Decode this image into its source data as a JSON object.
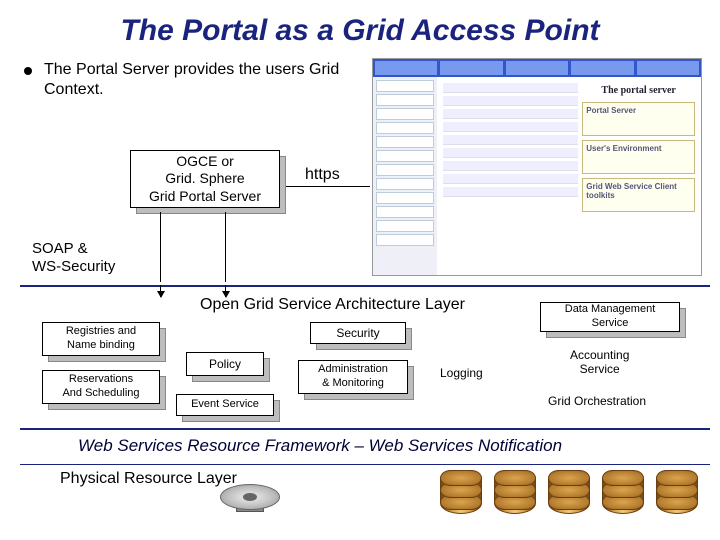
{
  "title": "The Portal as a Grid Access Point",
  "bullet": "The Portal Server provides the users Grid Context.",
  "boxes": {
    "portal_server": "OGCE or\nGrid. Sphere\nGrid Portal Server",
    "registries": "Registries and\nName binding",
    "reservations": "Reservations\nAnd Scheduling",
    "policy": "Policy",
    "event_service": "Event Service",
    "security": "Security",
    "admin": "Administration\n& Monitoring",
    "data_mgmt": "Data Management\nService"
  },
  "labels": {
    "https": "https",
    "soap": "SOAP &\nWS-Security",
    "ogsa": "Open Grid Service Architecture Layer",
    "logging": "Logging",
    "accounting": "Accounting\nService",
    "grid_orch": "Grid Orchestration"
  },
  "lines": {
    "wsrf": "Web Services Resource Framework – Web Services Notification",
    "physical": "Physical Resource Layer"
  },
  "screenshot": {
    "heading": "The portal server",
    "panel1": "Portal Server",
    "panel2": "User's Environment",
    "panel3": "Grid Web Service Client toolkits"
  }
}
